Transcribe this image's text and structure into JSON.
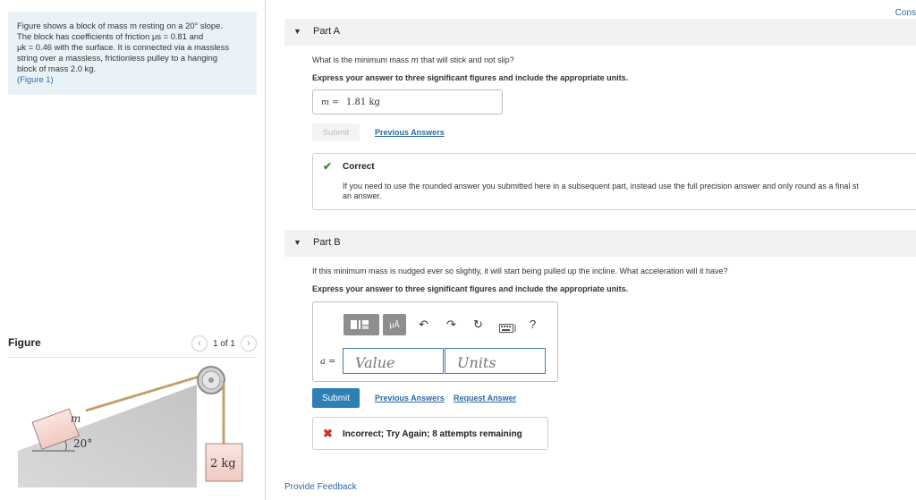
{
  "problem": {
    "line1": "Figure shows a block of mass m resting on a 20° slope.",
    "line2": "The block has coefficients of friction μs = 0.81 and",
    "line3": "μk = 0.46 with the surface. It is connected via a massless",
    "line4": "string over a massless, frictionless pulley to a hanging",
    "line5": "block of mass 2.0 kg.",
    "figure_link": "(Figure 1)"
  },
  "figure": {
    "title": "Figure",
    "pager": "1 of 1",
    "prev_glyph": "‹",
    "next_glyph": "›",
    "block_label": "m",
    "angle_label": "20°",
    "hanging_label": "2 kg"
  },
  "header": {
    "cons": "Cons"
  },
  "partA": {
    "label": "Part A",
    "question_pre": "What is the minimum mass",
    "question_var": "m",
    "question_post": "that will stick and not slip?",
    "instructions": "Express your answer to three significant figures and include the appropriate units.",
    "answer_var": "m =",
    "answer_value": "1.81 kg",
    "submit": "Submit",
    "previous_answers": "Previous Answers",
    "feedback_title": "Correct",
    "feedback_msg_1": "If you need to use the rounded answer you submitted here in a subsequent part, instead use the full precision answer and only round as a final st",
    "feedback_msg_2": "an answer."
  },
  "partB": {
    "label": "Part B",
    "question": "If this minimum mass is nudged ever so slightly, it will start being pulled up the incline. What acceleration will it have?",
    "instructions": "Express your answer to three significant figures and include the appropriate units.",
    "toolbar": {
      "templates_icon": "templates-icon",
      "units_button": "μÅ",
      "undo_icon": "↶",
      "redo_icon": "↷",
      "reset_icon": "↻",
      "keyboard_icon": "keyboard-icon",
      "help": "?"
    },
    "answer_var": "a =",
    "value_placeholder": "Value",
    "units_placeholder": "Units",
    "submit": "Submit",
    "previous_answers": "Previous Answers",
    "request_answer": "Request Answer",
    "feedback_msg": "Incorrect; Try Again; 8 attempts remaining"
  },
  "footer": {
    "provide_feedback": "Provide Feedback"
  },
  "colors": {
    "accent": "#2e7fb5",
    "link": "#2a6aa8",
    "correct": "#3b8a2f",
    "incorrect": "#c8332b",
    "problem_bg": "#e9f3f7"
  }
}
